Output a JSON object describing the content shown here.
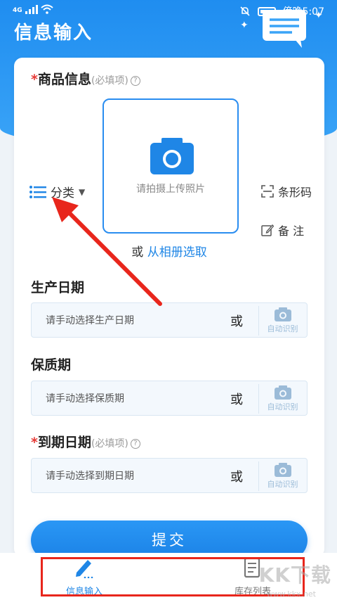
{
  "status_bar": {
    "network": "4G",
    "time": "傍晚5:07"
  },
  "header": {
    "title": "信息输入"
  },
  "product_section": {
    "title": "商品信息",
    "required_note": "(必填项)",
    "help": "?"
  },
  "photo": {
    "hint": "请拍摄上传照片"
  },
  "side_actions": {
    "category": "分类",
    "barcode": "条形码",
    "remark": "备 注"
  },
  "album": {
    "or": "或",
    "link": "从相册选取"
  },
  "fields": {
    "production_date": {
      "title": "生产日期",
      "placeholder": "请手动选择生产日期",
      "or": "或",
      "auto": "自动识别"
    },
    "shelf_life": {
      "title": "保质期",
      "placeholder": "请手动选择保质期",
      "or": "或",
      "auto": "自动识别"
    },
    "expiry_date": {
      "title": "到期日期",
      "required_note": "(必填项)",
      "help": "?",
      "placeholder": "请手动选择到期日期",
      "or": "或",
      "auto": "自动识别"
    }
  },
  "submit": {
    "label": "提交"
  },
  "bottom_nav": {
    "items": [
      {
        "label": "信息输入",
        "active": true
      },
      {
        "label": "库存列表",
        "active": false
      }
    ]
  },
  "watermark": {
    "text": "KK下载",
    "sub": "www.kkx.net"
  },
  "colors": {
    "primary": "#1f86e6",
    "annotation": "#e8261c"
  }
}
